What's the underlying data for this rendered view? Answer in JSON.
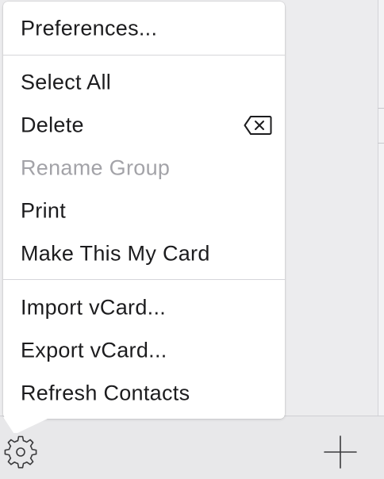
{
  "menu": {
    "items": [
      {
        "label": "Preferences...",
        "enabled": true
      },
      {
        "label": "Select All",
        "enabled": true
      },
      {
        "label": "Delete",
        "enabled": true,
        "shortcut_icon": "delete-key-icon"
      },
      {
        "label": "Rename Group",
        "enabled": false
      },
      {
        "label": "Print",
        "enabled": true
      },
      {
        "label": "Make This My Card",
        "enabled": true
      },
      {
        "label": "Import vCard...",
        "enabled": true
      },
      {
        "label": "Export vCard...",
        "enabled": true
      },
      {
        "label": "Refresh Contacts",
        "enabled": true
      }
    ]
  },
  "toolbar": {
    "gear_icon": "gear-icon",
    "add_icon": "plus-icon"
  },
  "colors": {
    "text": "#1c1c1e",
    "disabled_text": "#a3a3a8",
    "separator": "#d6d6da",
    "menu_background": "#ffffff",
    "window_background": "#ececee"
  }
}
